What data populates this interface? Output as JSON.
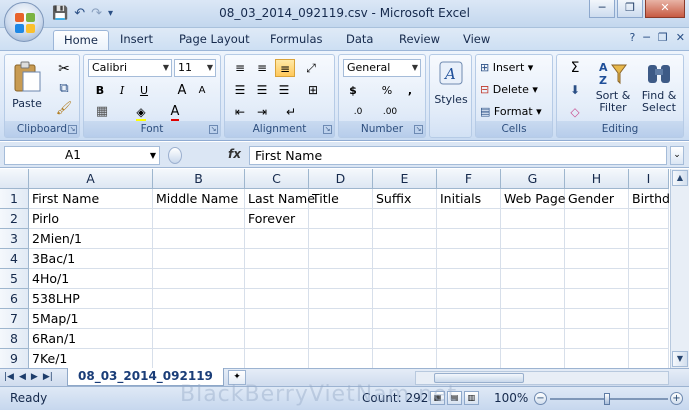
{
  "window": {
    "title": "08_03_2014_092119.csv - Microsoft Excel",
    "controls": {
      "minimize": "─",
      "restore": "❐",
      "close": "✕"
    }
  },
  "quick_access": {
    "save_icon": "💾",
    "undo_icon": "↶",
    "redo_icon": "↷",
    "customize_icon": "▾"
  },
  "tabs": [
    "Home",
    "Insert",
    "Page Layout",
    "Formulas",
    "Data",
    "Review",
    "View"
  ],
  "ribbon": {
    "clipboard": {
      "label": "Clipboard",
      "paste": "Paste"
    },
    "font": {
      "label": "Font",
      "name": "Calibri",
      "size": "11",
      "bold": "B",
      "italic": "I",
      "underline": "U",
      "grow": "A",
      "shrink": "A"
    },
    "alignment": {
      "label": "Alignment"
    },
    "number": {
      "label": "Number",
      "format": "General",
      "currency": "$",
      "percent": "%",
      "comma": ",",
      "inc_decimal": ".0",
      "dec_decimal": ".00"
    },
    "styles": {
      "label": "Styles"
    },
    "cells": {
      "label": "Cells",
      "insert": "Insert",
      "delete": "Delete",
      "format": "Format"
    },
    "editing": {
      "label": "Editing",
      "sum": "Σ",
      "sort_filter": "Sort &",
      "sort_filter2": "Filter",
      "find_select": "Find &",
      "find_select2": "Select"
    }
  },
  "formula_bar": {
    "name_box": "A1",
    "fx": "fx",
    "value": "First Name"
  },
  "grid": {
    "columns": [
      "A",
      "B",
      "C",
      "D",
      "E",
      "F",
      "G",
      "H",
      "I"
    ],
    "rows": [
      [
        "First Name",
        "Middle Name",
        "Last Name",
        "Title",
        "Suffix",
        "Initials",
        "Web Page",
        "Gender",
        "Birthd"
      ],
      [
        "Pirlo",
        "",
        "Forever",
        "",
        "",
        "",
        "",
        "",
        ""
      ],
      [
        "2Mien/1",
        "",
        "",
        "",
        "",
        "",
        "",
        "",
        ""
      ],
      [
        "3Bac/1",
        "",
        "",
        "",
        "",
        "",
        "",
        "",
        ""
      ],
      [
        "4Ho/1",
        "",
        "",
        "",
        "",
        "",
        "",
        "",
        ""
      ],
      [
        "538LHP",
        "",
        "",
        "",
        "",
        "",
        "",
        "",
        ""
      ],
      [
        "5Map/1",
        "",
        "",
        "",
        "",
        "",
        "",
        "",
        ""
      ],
      [
        "6Ran/1",
        "",
        "",
        "",
        "",
        "",
        "",
        "",
        ""
      ],
      [
        "7Ke/1",
        "",
        "",
        "",
        "",
        "",
        "",
        "",
        ""
      ]
    ],
    "row_numbers": [
      "1",
      "2",
      "3",
      "4",
      "5",
      "6",
      "7",
      "8",
      "9"
    ]
  },
  "sheet": {
    "tab": "08_03_2014_092119"
  },
  "status": {
    "ready": "Ready",
    "count": "Count: 292",
    "zoom": "100%"
  },
  "watermark": "BlackBerryVietNam.net"
}
